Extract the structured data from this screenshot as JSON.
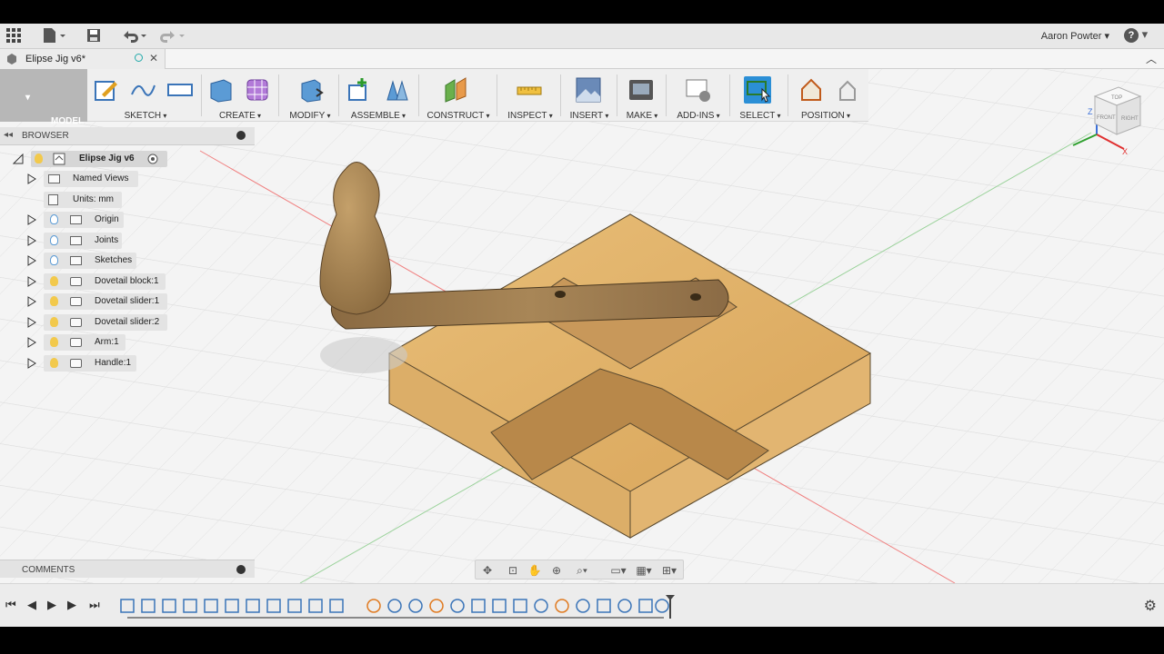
{
  "app": {
    "user_name": "Aaron Powter",
    "doc_tab_title": "Elipse Jig v6*"
  },
  "ribbon": {
    "workspace_label": "MODEL",
    "groups": [
      {
        "label": "SKETCH"
      },
      {
        "label": "CREATE"
      },
      {
        "label": "MODIFY"
      },
      {
        "label": "ASSEMBLE"
      },
      {
        "label": "CONSTRUCT"
      },
      {
        "label": "INSPECT"
      },
      {
        "label": "INSERT"
      },
      {
        "label": "MAKE"
      },
      {
        "label": "ADD-INS"
      },
      {
        "label": "SELECT"
      },
      {
        "label": "POSITION"
      }
    ]
  },
  "browser": {
    "title": "BROWSER",
    "root": "Elipse Jig v6",
    "items": [
      {
        "label": "Named Views"
      },
      {
        "label": "Units: mm"
      },
      {
        "label": "Origin"
      },
      {
        "label": "Joints"
      },
      {
        "label": "Sketches"
      },
      {
        "label": "Dovetail block:1"
      },
      {
        "label": "Dovetail slider:1"
      },
      {
        "label": "Dovetail slider:2"
      },
      {
        "label": "Arm:1"
      },
      {
        "label": "Handle:1"
      }
    ]
  },
  "comments": {
    "title": "COMMENTS"
  },
  "viewcube": {
    "axis_z": "Z",
    "axis_x": "X",
    "face_top": "TOP",
    "face_front": "FRONT",
    "face_right": "RIGHT"
  },
  "colors": {
    "accent_select": "#2b8fd6",
    "bulb_on": "#f2c94c",
    "bulb_off": "#5b9bd5",
    "wood": "#d9a95d"
  }
}
